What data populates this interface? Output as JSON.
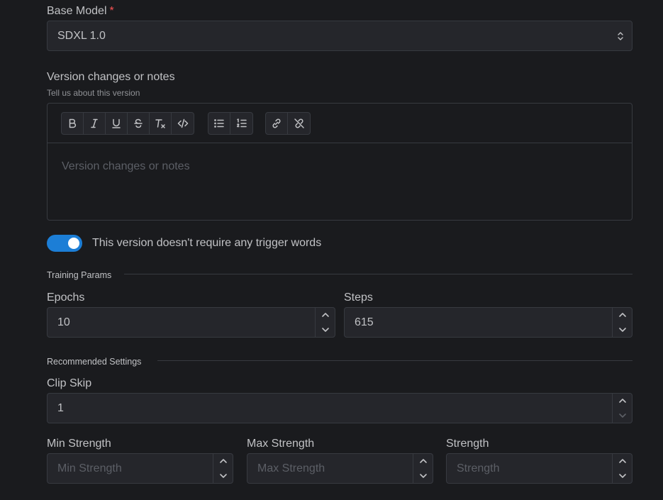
{
  "base_model": {
    "label": "Base Model",
    "required_mark": "*",
    "value": "SDXL 1.0"
  },
  "notes": {
    "label": "Version changes or notes",
    "description": "Tell us about this version",
    "placeholder": "Version changes or notes",
    "toolbar": [
      "bold",
      "italic",
      "underline",
      "strikethrough",
      "clear-formatting",
      "code",
      "bullet-list",
      "ordered-list",
      "link",
      "unlink"
    ]
  },
  "trigger_toggle": {
    "label": "This version doesn't require any trigger words",
    "checked": true
  },
  "training": {
    "section_title": "Training Params",
    "epochs_label": "Epochs",
    "epochs_value": "10",
    "steps_label": "Steps",
    "steps_value": "615"
  },
  "recommended": {
    "section_title": "Recommended Settings",
    "clip_skip_label": "Clip Skip",
    "clip_skip_value": "1",
    "min_strength_label": "Min Strength",
    "min_strength_placeholder": "Min Strength",
    "max_strength_label": "Max Strength",
    "max_strength_placeholder": "Max Strength",
    "strength_label": "Strength",
    "strength_placeholder": "Strength"
  },
  "colors": {
    "background": "#1a1b1e",
    "input_bg": "#25262b",
    "border": "#373a40",
    "accent": "#1c7ed6",
    "required": "#fa5252"
  }
}
